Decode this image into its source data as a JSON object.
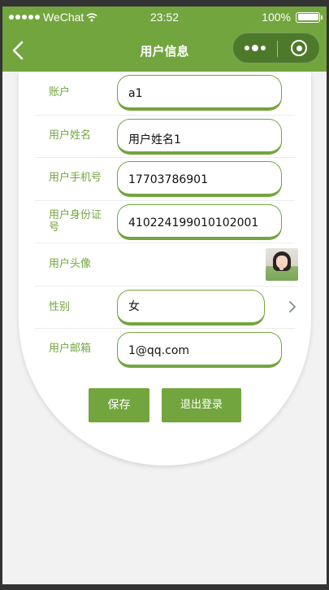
{
  "status_bar": {
    "carrier": "WeChat",
    "time": "23:52",
    "battery": "100%"
  },
  "nav": {
    "title": "用户信息",
    "back_icon": "chevron-left-icon",
    "more_icon": "more-dots-icon",
    "close_icon": "target-close-icon"
  },
  "form": {
    "rows": [
      {
        "label": "账户",
        "value": "a1"
      },
      {
        "label": "用户姓名",
        "value": "用户姓名1"
      },
      {
        "label": "用户手机号",
        "value": "17703786901"
      },
      {
        "label": "用户身份证号",
        "value": "410224199010102001"
      },
      {
        "label": "用户头像",
        "value": ""
      },
      {
        "label": "性别",
        "value": "女"
      },
      {
        "label": "用户邮箱",
        "value": "1@qq.com"
      }
    ]
  },
  "buttons": {
    "save": "保存",
    "logout": "退出登录"
  },
  "colors": {
    "accent": "#73a53e",
    "background": "#f2f2f2",
    "card": "#ffffff"
  }
}
